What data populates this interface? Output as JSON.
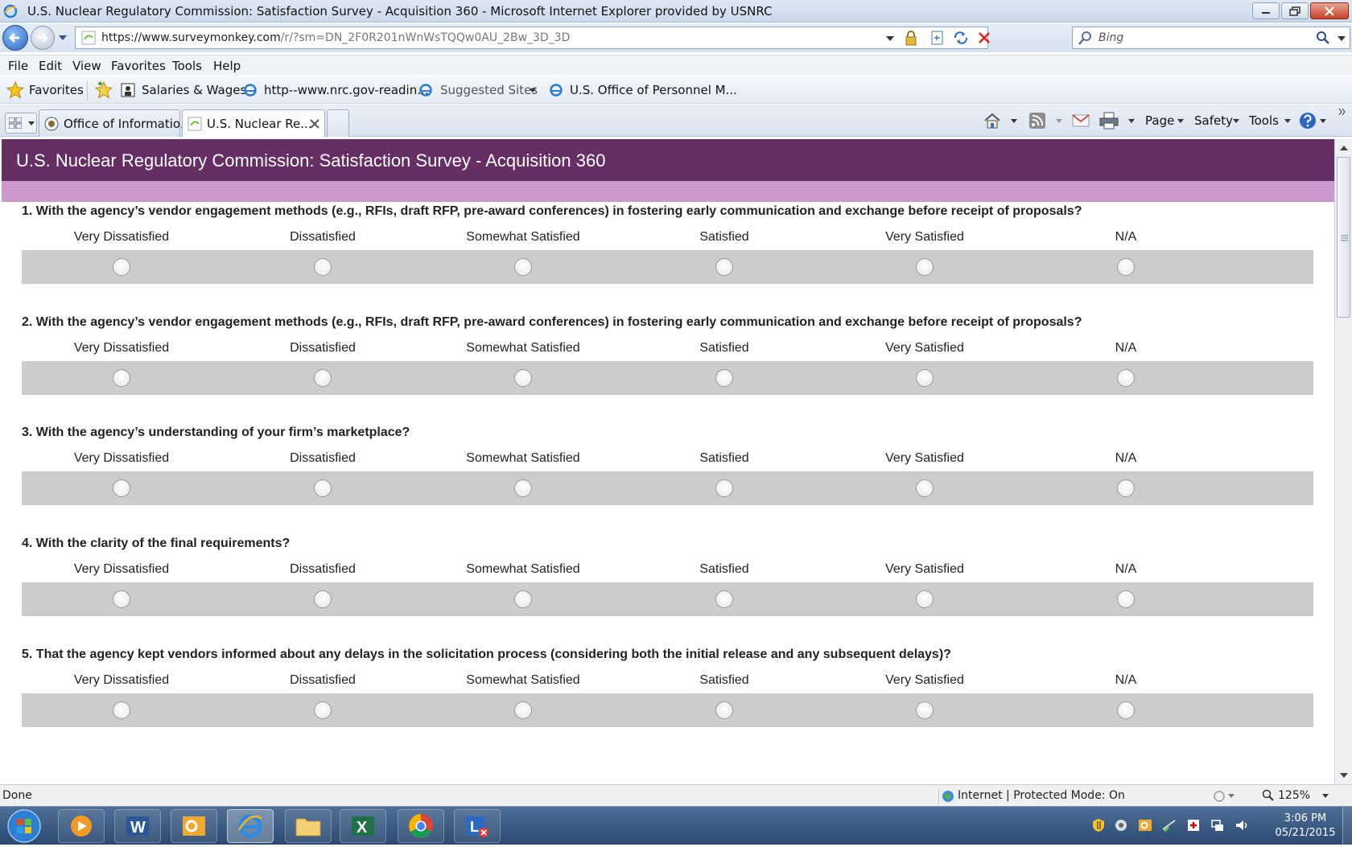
{
  "window": {
    "title": "U.S. Nuclear Regulatory Commission: Satisfaction Survey - Acquisition 360 - Microsoft Internet Explorer provided by USNRC"
  },
  "address_bar": {
    "url_host": "https://www.surveymonkey.com",
    "url_path": "/r/?sm=DN_2F0R201nWnWsTQQw0AU_2Bw_3D_3D",
    "search_placeholder": "Bing"
  },
  "menu": [
    "File",
    "Edit",
    "View",
    "Favorites",
    "Tools",
    "Help"
  ],
  "favorites_bar": {
    "favorites_label": "Favorites",
    "items": [
      "Salaries & Wages",
      "http--www.nrc.gov-readin...",
      "Suggested Sites",
      "U.S. Office of Personnel M..."
    ]
  },
  "tabs": [
    {
      "label": "Office of Informatio...",
      "active": false
    },
    {
      "label": "U.S. Nuclear Re...",
      "active": true
    }
  ],
  "command_bar": {
    "page": "Page",
    "safety": "Safety",
    "tools": "Tools"
  },
  "survey": {
    "header_title": "U.S. Nuclear Regulatory Commission: Satisfaction Survey - Acquisition 360",
    "header_color": "#662f63",
    "band_color": "#cc99cc",
    "scale": [
      "Very Dissatisfied",
      "Dissatisfied",
      "Somewhat Satisfied",
      "Satisfied",
      "Very Satisfied",
      "N/A"
    ],
    "questions": [
      "1. With the agency’s vendor engagement methods (e.g., RFIs, draft RFP, pre-award conferences) in fostering early communication and exchange before receipt of proposals?",
      "2. With the agency’s vendor engagement methods (e.g., RFIs, draft RFP, pre-award conferences) in fostering early communication and exchange before receipt of proposals?",
      "3. With the agency’s understanding of your firm’s marketplace?",
      "4. With the clarity of the final requirements?",
      "5. That the agency kept vendors informed about any delays in the solicitation process (considering both the initial release and any subsequent delays)?"
    ]
  },
  "status_bar": {
    "left": "Done",
    "zone": "Internet | Protected Mode: On",
    "zoom": "125%"
  },
  "taskbar": {
    "time": "3:06 PM",
    "date": "05/21/2015"
  }
}
